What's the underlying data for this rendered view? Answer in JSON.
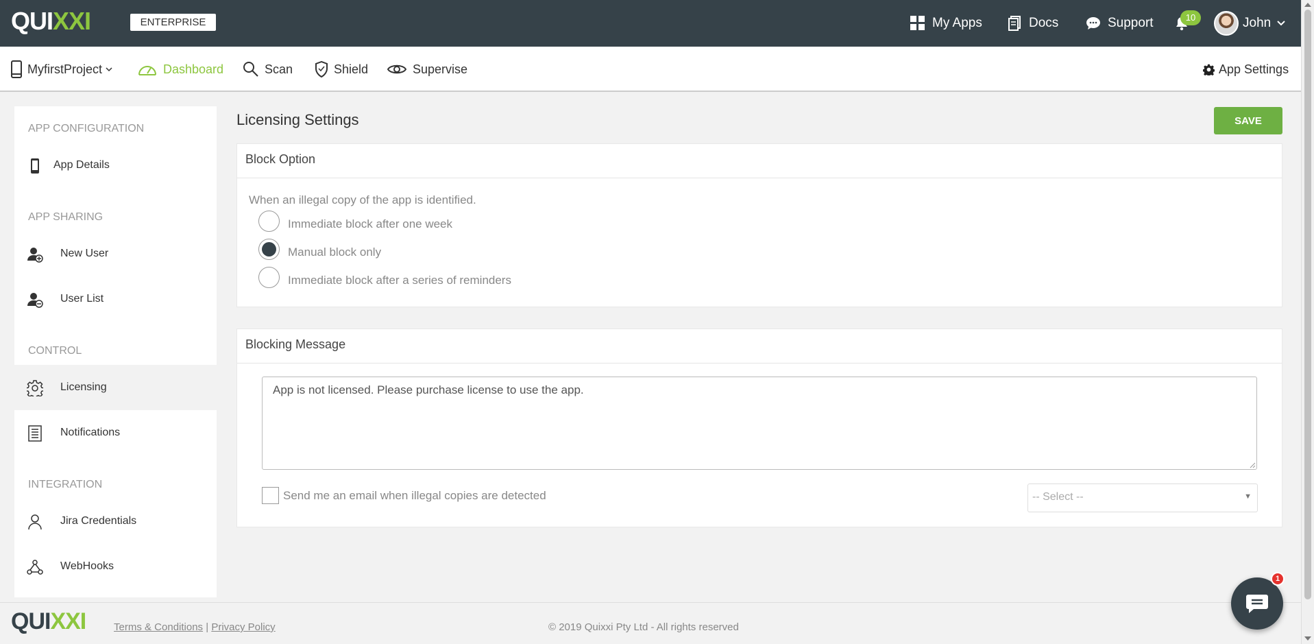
{
  "brand": {
    "logo_primary": "QUI",
    "logo_accent": "XXI",
    "edition": "ENTERPRISE",
    "accent_color": "#8dc63f",
    "header_color": "#364249"
  },
  "topnav": {
    "my_apps": "My Apps",
    "docs": "Docs",
    "support": "Support",
    "notification_count": "10",
    "user": "John"
  },
  "subnav": {
    "project": "MyfirstProject",
    "dashboard": "Dashboard",
    "scan": "Scan",
    "shield": "Shield",
    "supervise": "Supervise",
    "app_settings": "App Settings"
  },
  "sidebar": {
    "sections": {
      "app_configuration": "APP CONFIGURATION",
      "app_sharing": "APP SHARING",
      "control": "CONTROL",
      "integration": "INTEGRATION"
    },
    "items": {
      "app_details": "App Details",
      "new_user": "New User",
      "user_list": "User List",
      "licensing": "Licensing",
      "notifications": "Notifications",
      "jira_credentials": "Jira Credentials",
      "webhooks": "WebHooks"
    }
  },
  "main": {
    "title": "Licensing Settings",
    "save_label": "SAVE",
    "block_option": {
      "heading": "Block Option",
      "prompt": "When an illegal copy of the app is identified.",
      "options": [
        "Immediate block after one week",
        "Manual block only",
        "Immediate block after a series of reminders"
      ],
      "selected": "Manual block only"
    },
    "blocking_message": {
      "heading": "Blocking Message",
      "message": "App is not licensed. Please purchase license to use the app.",
      "email_checkbox_label": "Send me an email when illegal copies are detected",
      "email_checked": false,
      "select_value": "-- Select --"
    }
  },
  "footer": {
    "terms": "Terms & Conditions",
    "separator": "|",
    "privacy": "Privacy Policy",
    "copyright": "© 2019 Quixxi Pty Ltd - All rights reserved"
  },
  "chat": {
    "unread": "1"
  }
}
